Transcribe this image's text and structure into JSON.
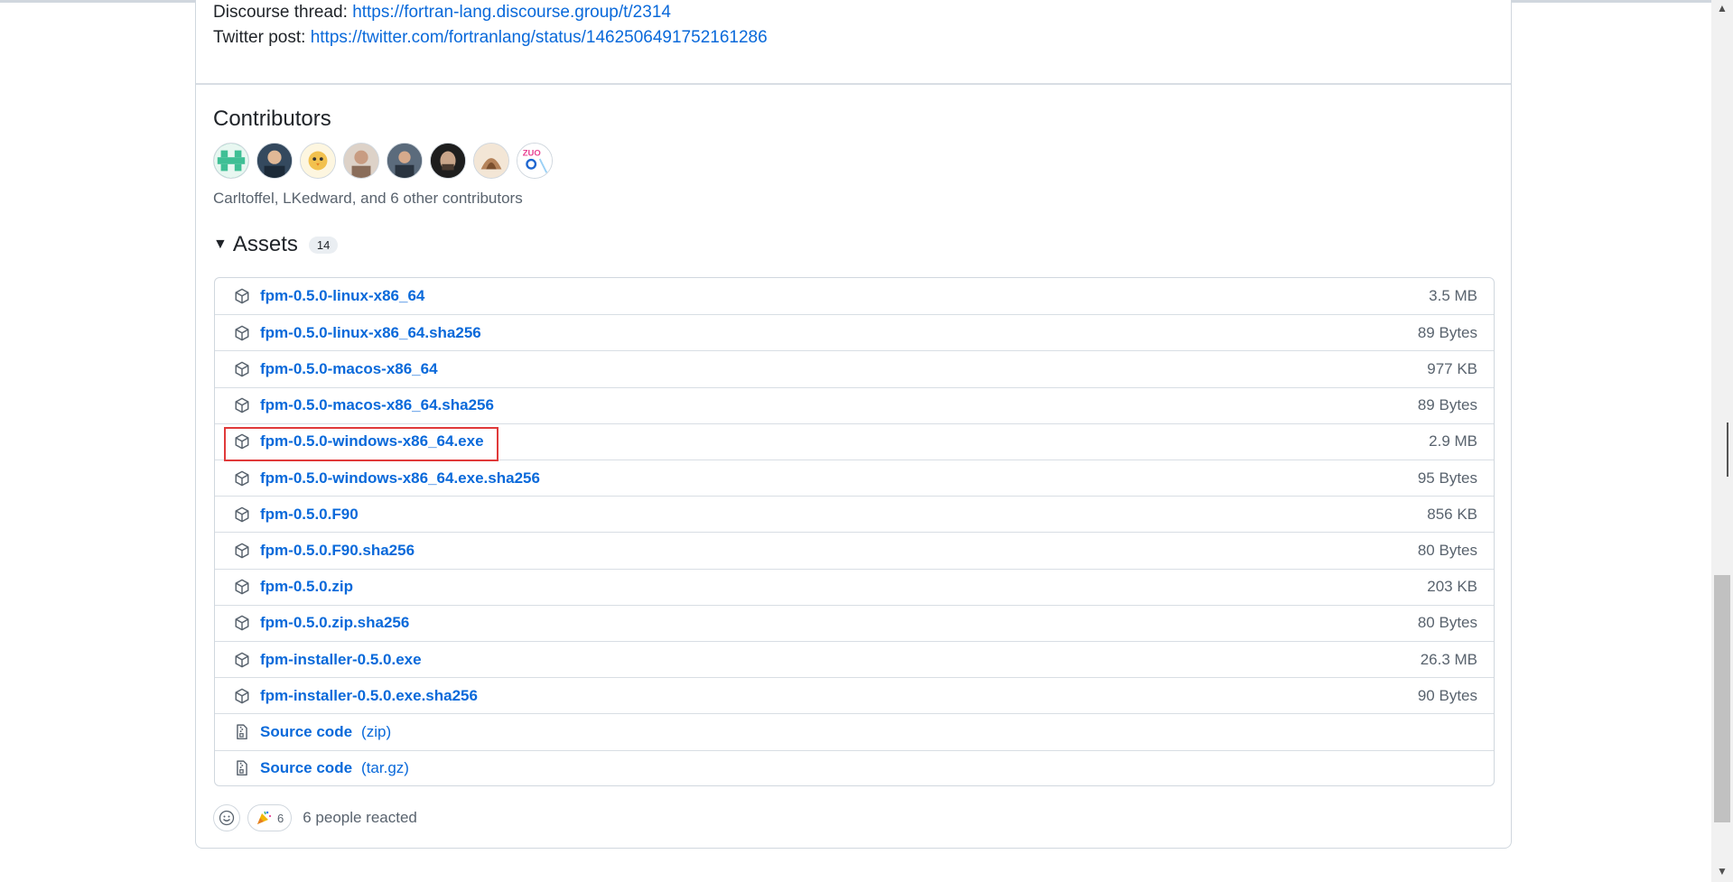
{
  "release_notes": {
    "discourse_label": "Discourse thread: ",
    "discourse_url": "https://fortran-lang.discourse.group/t/2314",
    "twitter_label": "Twitter post: ",
    "twitter_url": "https://twitter.com/fortranlang/status/1462506491752161286"
  },
  "contributors": {
    "title": "Contributors",
    "summary": "Carltoffel, LKedward, and 6 other contributors",
    "avatars": [
      {
        "color": "#3fbf95"
      },
      {
        "color": "#2c3e50"
      },
      {
        "color": "#f2c14e"
      },
      {
        "color": "#8a6d5a"
      },
      {
        "color": "#3a4a5c"
      },
      {
        "color": "#1e1e1e"
      },
      {
        "color": "#b5835a"
      },
      {
        "color": "#ffffff"
      }
    ]
  },
  "assets": {
    "title": "Assets",
    "count": "14",
    "items": [
      {
        "name": "fpm-0.5.0-linux-x86_64",
        "size": "3.5 MB",
        "icon": "package-icon"
      },
      {
        "name": "fpm-0.5.0-linux-x86_64.sha256",
        "size": "89 Bytes",
        "icon": "package-icon"
      },
      {
        "name": "fpm-0.5.0-macos-x86_64",
        "size": "977 KB",
        "icon": "package-icon"
      },
      {
        "name": "fpm-0.5.0-macos-x86_64.sha256",
        "size": "89 Bytes",
        "icon": "package-icon"
      },
      {
        "name": "fpm-0.5.0-windows-x86_64.exe",
        "size": "2.9 MB",
        "icon": "package-icon"
      },
      {
        "name": "fpm-0.5.0-windows-x86_64.exe.sha256",
        "size": "95 Bytes",
        "icon": "package-icon"
      },
      {
        "name": "fpm-0.5.0.F90",
        "size": "856 KB",
        "icon": "package-icon"
      },
      {
        "name": "fpm-0.5.0.F90.sha256",
        "size": "80 Bytes",
        "icon": "package-icon"
      },
      {
        "name": "fpm-0.5.0.zip",
        "size": "203 KB",
        "icon": "package-icon"
      },
      {
        "name": "fpm-0.5.0.zip.sha256",
        "size": "80 Bytes",
        "icon": "package-icon"
      },
      {
        "name": "fpm-installer-0.5.0.exe",
        "size": "26.3 MB",
        "icon": "package-icon"
      },
      {
        "name": "fpm-installer-0.5.0.exe.sha256",
        "size": "90 Bytes",
        "icon": "package-icon"
      }
    ],
    "source": [
      {
        "name": "Source code",
        "ext": "(zip)",
        "icon": "file-zip-icon"
      },
      {
        "name": "Source code",
        "ext": "(tar.gz)",
        "icon": "file-zip-icon"
      }
    ]
  },
  "reactions": {
    "party_count": "6",
    "summary": "6 people reacted"
  },
  "colors": {
    "link": "#0969da",
    "muted": "#59636e",
    "border": "#d0d7de",
    "highlight": "#e03a3a"
  }
}
